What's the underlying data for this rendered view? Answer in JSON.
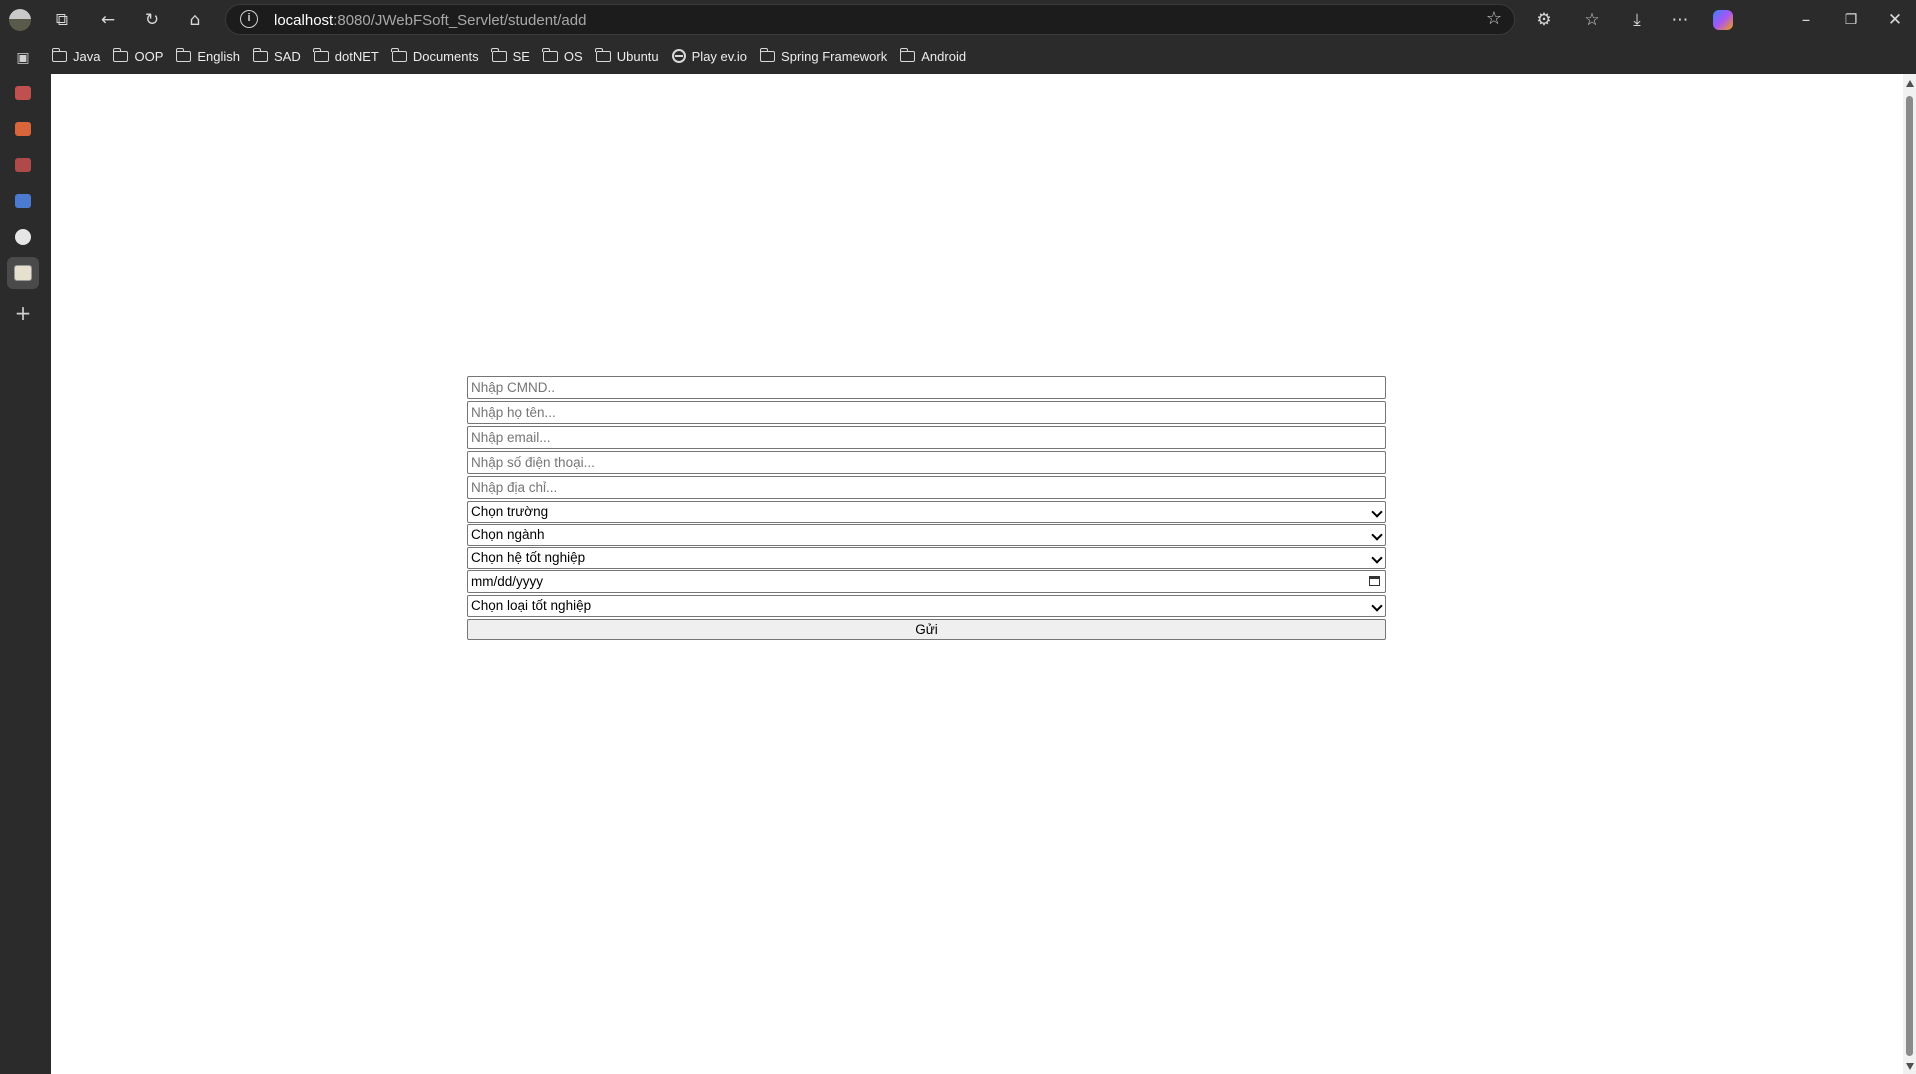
{
  "browser": {
    "url_host": "localhost",
    "url_rest": ":8080/JWebFSoft_Servlet/student/add",
    "bookmarks": [
      {
        "label": "Java",
        "icon": "folder-icon"
      },
      {
        "label": "OOP",
        "icon": "folder-icon"
      },
      {
        "label": "English",
        "icon": "folder-icon"
      },
      {
        "label": "SAD",
        "icon": "folder-icon"
      },
      {
        "label": "dotNET",
        "icon": "folder-icon"
      },
      {
        "label": "Documents",
        "icon": "folder-icon"
      },
      {
        "label": "SE",
        "icon": "folder-icon"
      },
      {
        "label": "OS",
        "icon": "folder-icon"
      },
      {
        "label": "Ubuntu",
        "icon": "folder-icon"
      },
      {
        "label": "Play ev.io",
        "icon": "globe-icon"
      },
      {
        "label": "Spring Framework",
        "icon": "folder-icon"
      },
      {
        "label": "Android",
        "icon": "folder-icon"
      }
    ]
  },
  "form": {
    "cmnd_placeholder": "Nhập CMND..",
    "name_placeholder": "Nhập họ tên...",
    "email_placeholder": "Nhập email...",
    "phone_placeholder": "Nhập số điện thoại...",
    "address_placeholder": "Nhập địa chỉ...",
    "school_select": "Chọn trường",
    "major_select": "Chọn ngành",
    "grad_system_select": "Chọn hệ tốt nghiệp",
    "date_placeholder": "mm/dd/yyyy",
    "grad_type_select": "Chọn loại tốt nghiệp",
    "submit_label": "Gửi"
  },
  "colors": {
    "browser_chrome": "#2b2b2b",
    "page_background": "#ffffff"
  }
}
